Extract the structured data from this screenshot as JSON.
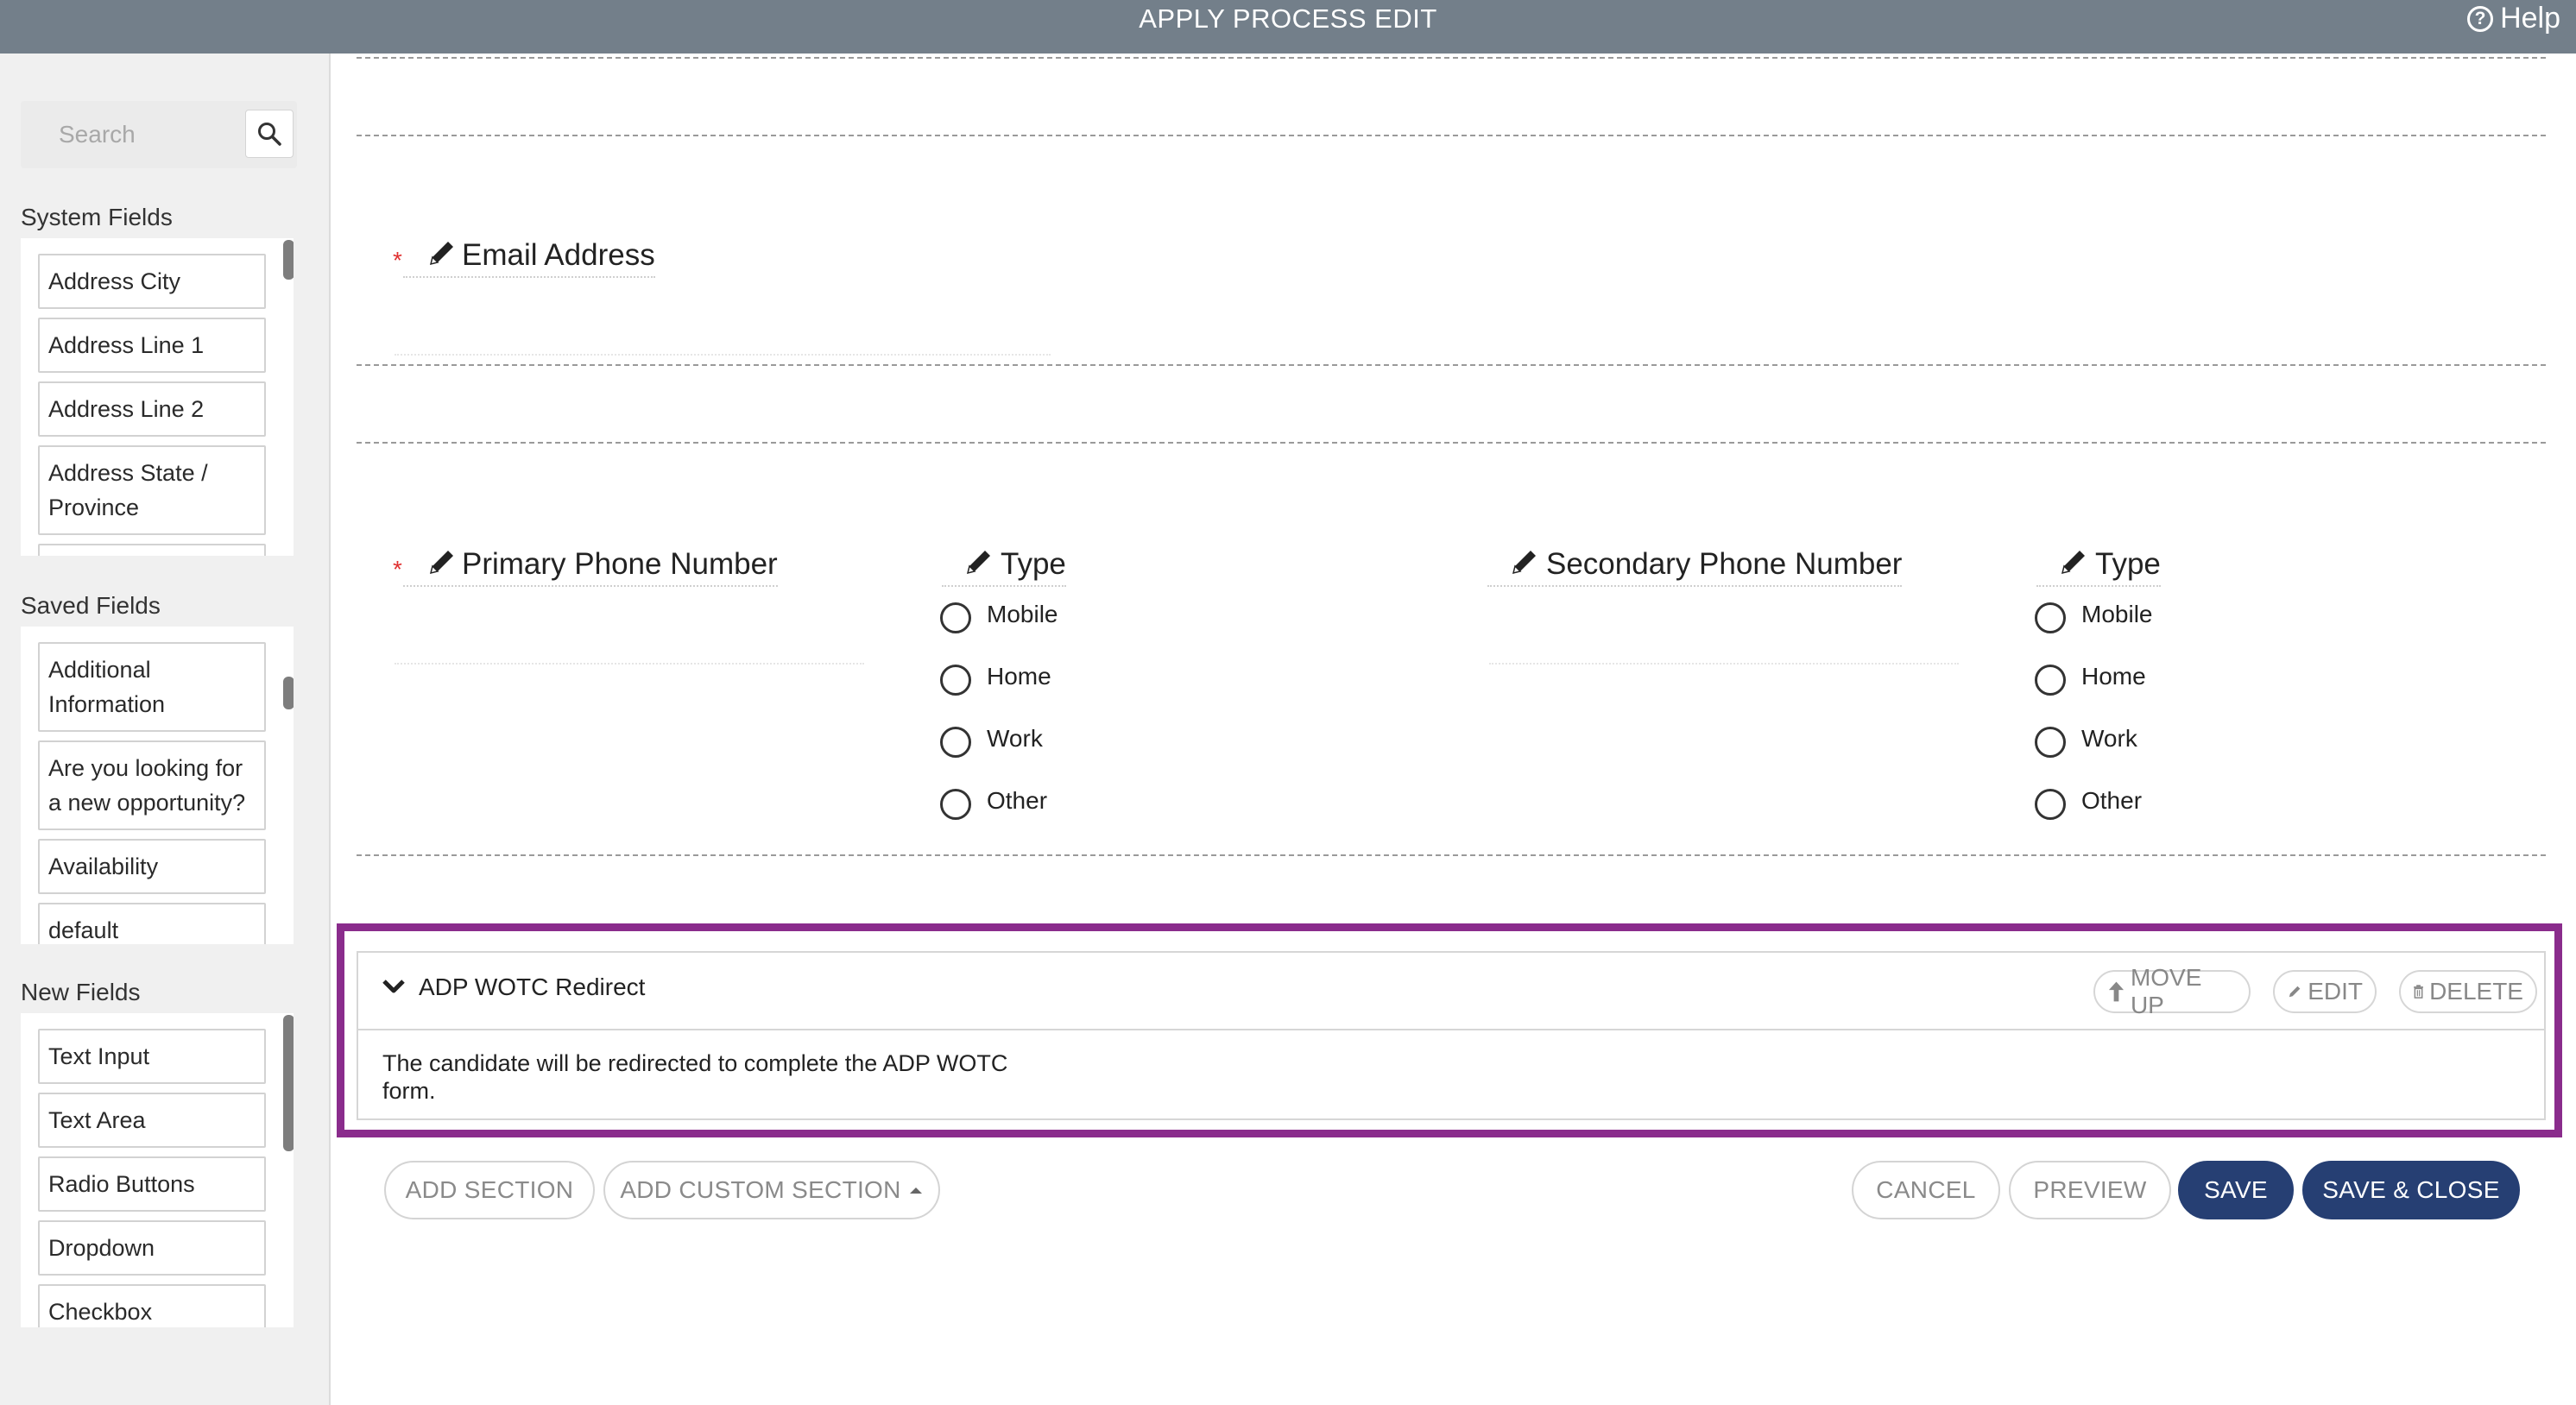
{
  "header": {
    "title": "APPLY PROCESS EDIT",
    "help_label": "Help"
  },
  "sidebar": {
    "search_placeholder": "Search",
    "system_fields": {
      "title": "System Fields",
      "items": [
        "Address City",
        "Address Line 1",
        "Address Line 2",
        "Address State / Province"
      ]
    },
    "saved_fields": {
      "title": "Saved Fields",
      "items": [
        "Additional Information",
        "Are you looking for a new opportunity?",
        "Availability",
        "default"
      ]
    },
    "new_fields": {
      "title": "New Fields",
      "items": [
        "Text Input",
        "Text Area",
        "Radio Buttons",
        "Dropdown",
        "Checkbox"
      ]
    }
  },
  "form": {
    "email": {
      "required_mark": "*",
      "label": "Email Address"
    },
    "primary_phone": {
      "required_mark": "*",
      "label": "Primary Phone Number"
    },
    "primary_type": {
      "label": "Type",
      "options": [
        "Mobile",
        "Home",
        "Work",
        "Other"
      ]
    },
    "secondary_phone": {
      "label": "Secondary Phone Number"
    },
    "secondary_type": {
      "label": "Type",
      "options": [
        "Mobile",
        "Home",
        "Work",
        "Other"
      ]
    }
  },
  "section": {
    "title": "ADP WOTC Redirect",
    "move_up_label": "MOVE UP",
    "edit_label": "EDIT",
    "delete_label": "DELETE",
    "body": "The candidate will be redirected to complete the ADP WOTC form.",
    "highlight_color": "#8a2c8c"
  },
  "actions": {
    "add_section": "ADD SECTION",
    "add_custom_section": "ADD CUSTOM SECTION",
    "cancel": "CANCEL",
    "preview": "PREVIEW",
    "save": "SAVE",
    "save_close": "SAVE & CLOSE",
    "primary_color": "#263f73"
  }
}
